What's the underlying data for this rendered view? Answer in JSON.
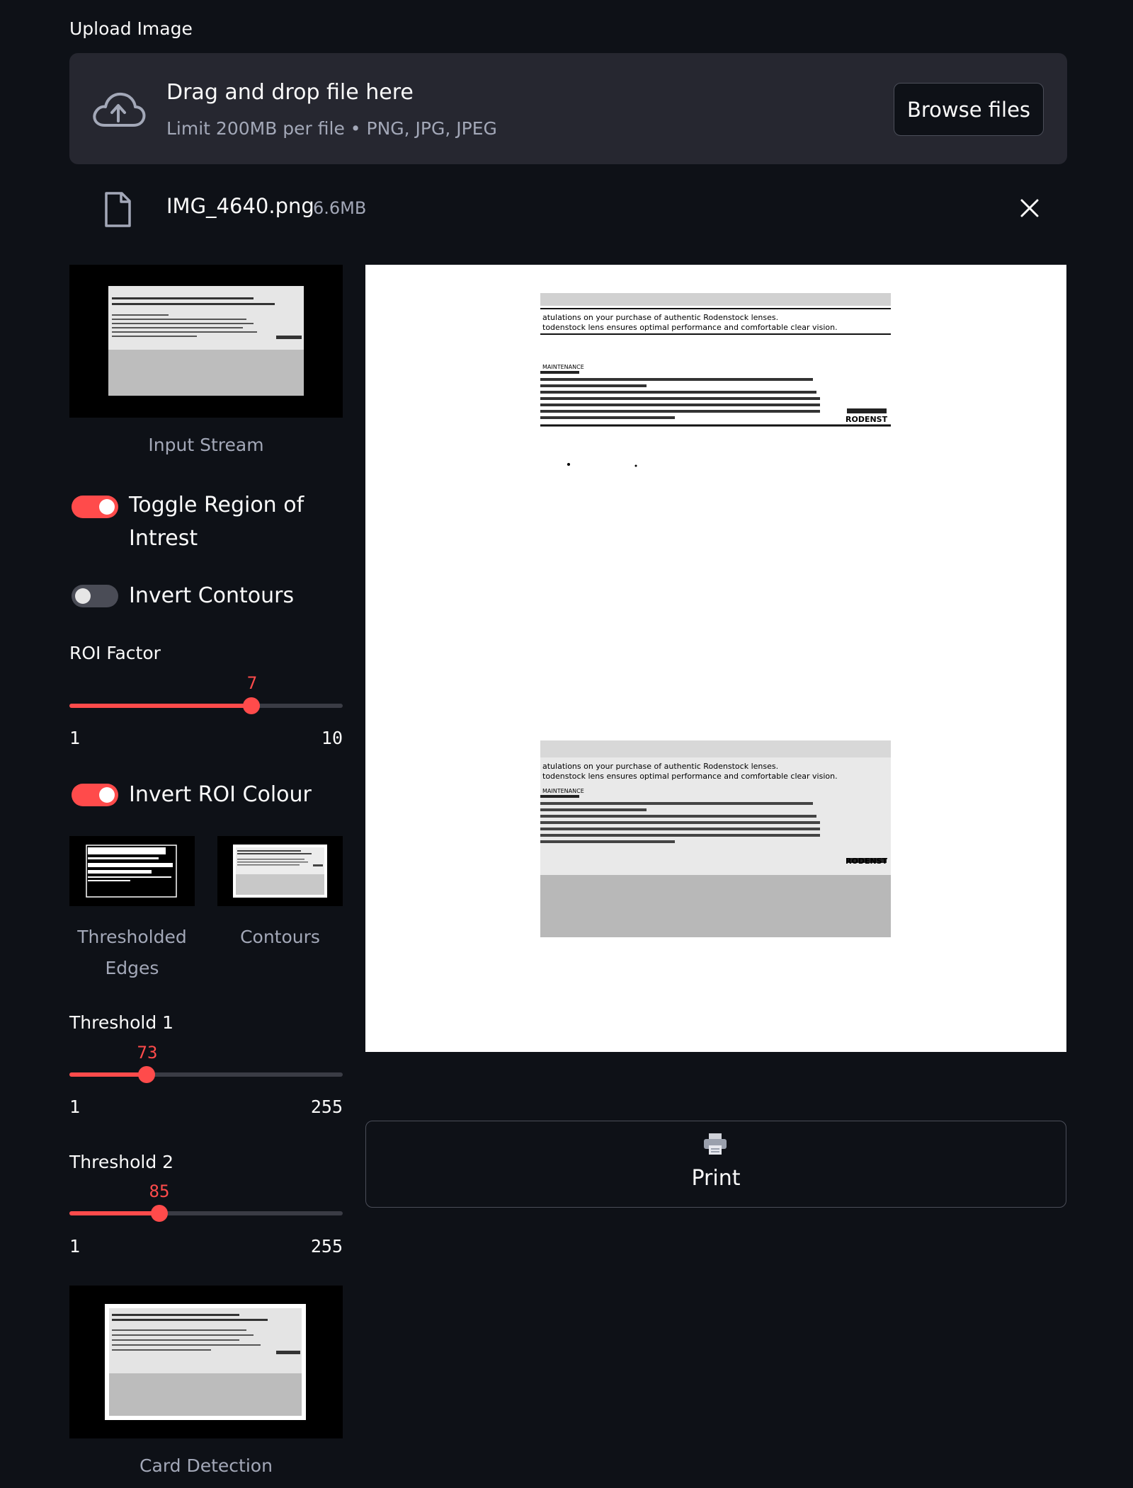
{
  "upload": {
    "label": "Upload Image",
    "drop_title": "Drag and drop file here",
    "drop_limit": "Limit 200MB per file • PNG, JPG, JPEG",
    "browse_label": "Browse files",
    "icon": "cloud-upload-icon"
  },
  "file": {
    "name": "IMG_4640.png",
    "size": "6.6MB",
    "icon": "file-icon",
    "remove_icon": "close-icon"
  },
  "sidebar": {
    "input_stream_caption": "Input Stream",
    "toggle_roi": {
      "label": "Toggle Region of Intrest",
      "on": true
    },
    "invert_contours": {
      "label": "Invert Contours",
      "on": false
    },
    "roi_factor": {
      "label": "ROI Factor",
      "value": "7",
      "min": "1",
      "max": "10",
      "fraction": 0.667
    },
    "invert_roi_colour": {
      "label": "Invert ROI Colour",
      "on": true
    },
    "thresholded_edges_caption": "Thresholded Edges",
    "contours_caption": "Contours",
    "threshold1": {
      "label": "Threshold 1",
      "value": "73",
      "min": "1",
      "max": "255",
      "fraction": 0.283
    },
    "threshold2": {
      "label": "Threshold 2",
      "value": "85",
      "min": "1",
      "max": "255",
      "fraction": 0.331
    },
    "card_detection_caption": "Card Detection"
  },
  "preview": {
    "doc_heading": "atulations on your purchase of authentic Rodenstock lenses.",
    "doc_subheading": "todenstock lens ensures optimal performance and comfortable clear vision.",
    "doc_section": "MAINTENANCE",
    "doc_brand": "RODENST"
  },
  "actions": {
    "print_label": "Print",
    "print_icon": "printer-icon"
  },
  "colors": {
    "background": "#0e1117",
    "surface": "#262730",
    "accent": "#ff4b4b"
  }
}
